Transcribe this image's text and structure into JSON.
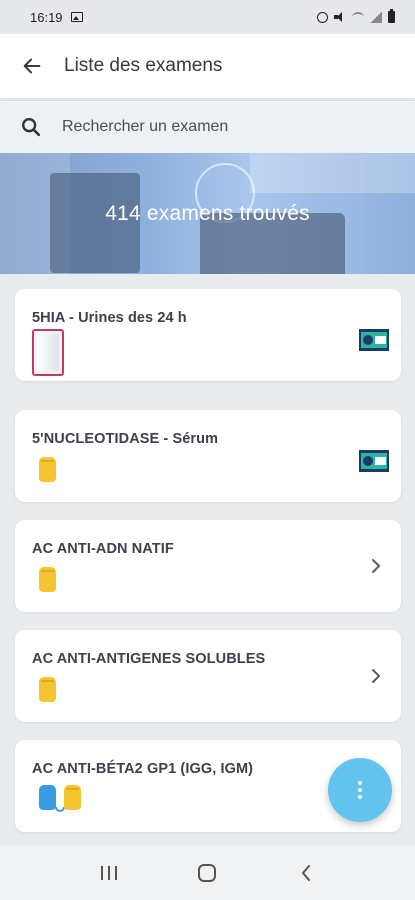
{
  "status_bar": {
    "time": "16:19",
    "icons": [
      "gallery-icon",
      "alarm-icon",
      "mute-icon",
      "wifi-icon",
      "signal-icon",
      "battery-icon"
    ]
  },
  "header": {
    "title": "Liste des examens",
    "back_icon": "arrow-left-icon"
  },
  "search": {
    "placeholder": "Rechercher un examen",
    "value": ""
  },
  "banner": {
    "count_text": "414 examens trouvés"
  },
  "exams": [
    {
      "title": "5HIA - Urines des 24 h",
      "sample": "urine-container",
      "action": "badge-icon"
    },
    {
      "title": "5'NUCLEOTIDASE - Sérum",
      "sample": "yellow-tube",
      "action": "badge-icon"
    },
    {
      "title": "AC ANTI-ADN NATIF",
      "sample": "yellow-tube",
      "action": "chevron-right-icon"
    },
    {
      "title": "AC ANTI-ANTIGENES SOLUBLES",
      "sample": "yellow-tube",
      "action": "chevron-right-icon"
    },
    {
      "title": "AC ANTI-BÉTA2 GP1 (IGG, IGM)",
      "sample": "blue-and-yellow-tubes",
      "action": "none"
    }
  ],
  "fab": {
    "icon": "more-vertical-icon"
  },
  "colors": {
    "accent": "#63c3ee",
    "tube_yellow": "#f4c531",
    "tube_blue": "#3b9be0",
    "badge_navy": "#1d3a66",
    "badge_teal": "#2cb5a0"
  }
}
